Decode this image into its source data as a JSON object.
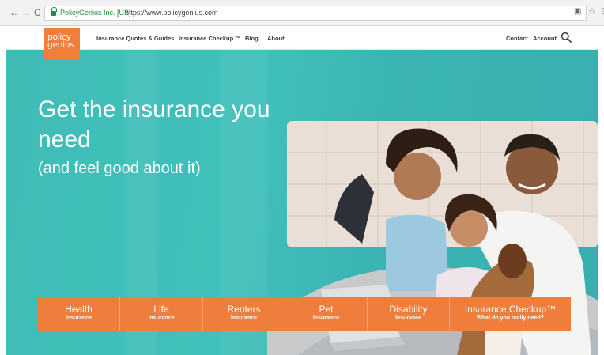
{
  "browser": {
    "back_glyph": "←",
    "forward_glyph": "→",
    "reload_glyph": "C",
    "site_identity": "PolicyGenius Inc. [US]",
    "url": "https://www.policygenius.com",
    "icons": [
      "lock-icon",
      "extension-icon",
      "bookmark-star-icon",
      "menu-icon"
    ]
  },
  "header": {
    "logo_line1": "policy",
    "logo_line2": "genius",
    "nav": [
      "Insurance Quotes & Guides",
      "Insurance Checkup ™",
      "Blog",
      "About"
    ],
    "right_nav": [
      "Contact",
      "Account"
    ],
    "brand_color": "#f07f3c"
  },
  "hero": {
    "title": "Get the insurance you need",
    "subtitle": "(and feel good about it)",
    "background_color": "#3fbcb6"
  },
  "tiles": [
    {
      "name": "Health",
      "sub": "Insurance"
    },
    {
      "name": "Life",
      "sub": "Insurance"
    },
    {
      "name": "Renters",
      "sub": "Insurance"
    },
    {
      "name": "Pet",
      "sub": "Insurance"
    },
    {
      "name": "Disability",
      "sub": "Insurance"
    },
    {
      "name": "Insurance Checkup™",
      "sub": "What do you really need?"
    }
  ],
  "tile_color": "#ef7d3b"
}
